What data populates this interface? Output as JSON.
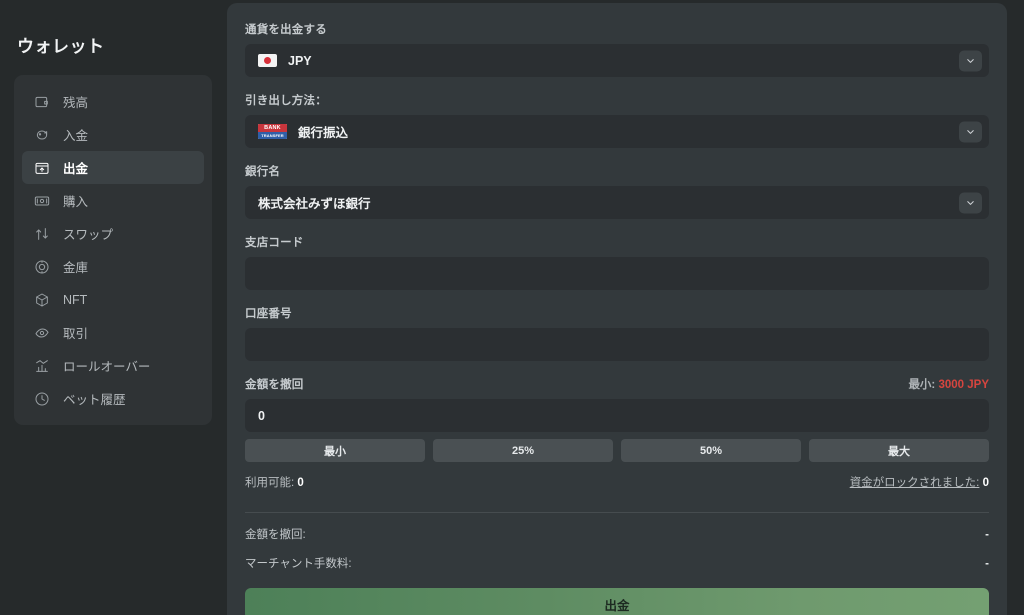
{
  "sidebar": {
    "title": "ウォレット",
    "items": [
      {
        "label": "残高",
        "icon": "wallet-icon",
        "active": false
      },
      {
        "label": "入金",
        "icon": "piggy-bank-icon",
        "active": false
      },
      {
        "label": "出金",
        "icon": "withdraw-icon",
        "active": true
      },
      {
        "label": "購入",
        "icon": "banknote-icon",
        "active": false
      },
      {
        "label": "スワップ",
        "icon": "swap-icon",
        "active": false
      },
      {
        "label": "金庫",
        "icon": "vault-icon",
        "active": false
      },
      {
        "label": "NFT",
        "icon": "cube-icon",
        "active": false
      },
      {
        "label": "取引",
        "icon": "trade-icon",
        "active": false
      },
      {
        "label": "ロールオーバー",
        "icon": "bar-chart-icon",
        "active": false
      },
      {
        "label": "ベット履歴",
        "icon": "clock-icon",
        "active": false
      }
    ]
  },
  "form": {
    "currency": {
      "label": "通貨を出金する",
      "value": "JPY",
      "icon": "flag-jp-icon",
      "chevron": "chevron-down-icon"
    },
    "method": {
      "label": "引き出し方法：",
      "value": "銀行振込",
      "icon": "bank-transfer-icon",
      "logo_top": "BANK",
      "logo_bottom": "TRANSFER",
      "chevron": "chevron-down-icon"
    },
    "bank_name": {
      "label": "銀行名",
      "value": "株式会社みずほ銀行",
      "chevron": "chevron-down-icon"
    },
    "branch_code": {
      "label": "支店コード",
      "value": "",
      "placeholder": ""
    },
    "account_number": {
      "label": "口座番号",
      "value": "",
      "placeholder": ""
    },
    "amount": {
      "label": "金額を撤回",
      "min_prefix": "最小:",
      "min_value": "3000 JPY",
      "min_color": "#d6453f",
      "value": "0",
      "quick_buttons": [
        "最小",
        "25%",
        "50%",
        "最大"
      ]
    },
    "balances": {
      "available_label": "利用可能:",
      "available_value": "0",
      "locked_label": "資金がロックされました:",
      "locked_value": "0"
    },
    "summary": [
      {
        "label": "金額を撤回:",
        "value": "-"
      },
      {
        "label": "マーチャント手数料:",
        "value": "-"
      }
    ],
    "submit_label": "出金"
  }
}
